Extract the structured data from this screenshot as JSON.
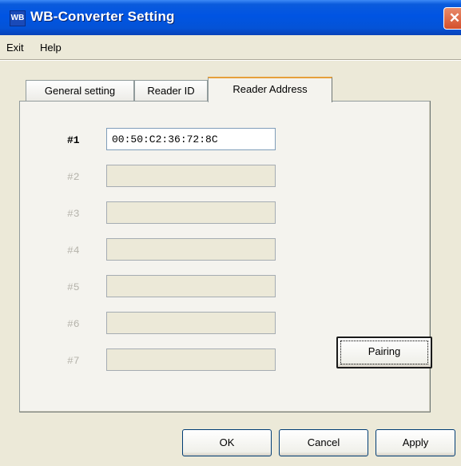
{
  "window": {
    "title": "WB-Converter Setting",
    "icon_text": "WB",
    "close_glyph": "✕"
  },
  "menu": [
    {
      "label": "Exit",
      "accel": "x"
    },
    {
      "label": "Help",
      "accel": "H"
    }
  ],
  "tabs": [
    {
      "label": "General setting",
      "active": false
    },
    {
      "label": "Reader ID",
      "active": false
    },
    {
      "label": "Reader Address",
      "active": true
    }
  ],
  "readers": [
    {
      "label": "#1",
      "value": "00:50:C2:36:72:8C",
      "enabled": true
    },
    {
      "label": "#2",
      "value": "",
      "enabled": false
    },
    {
      "label": "#3",
      "value": "",
      "enabled": false
    },
    {
      "label": "#4",
      "value": "",
      "enabled": false
    },
    {
      "label": "#5",
      "value": "",
      "enabled": false
    },
    {
      "label": "#6",
      "value": "",
      "enabled": false
    },
    {
      "label": "#7",
      "value": "",
      "enabled": false
    }
  ],
  "buttons": {
    "pairing": "Pairing",
    "ok": "OK",
    "cancel": "Cancel",
    "apply": "Apply"
  }
}
